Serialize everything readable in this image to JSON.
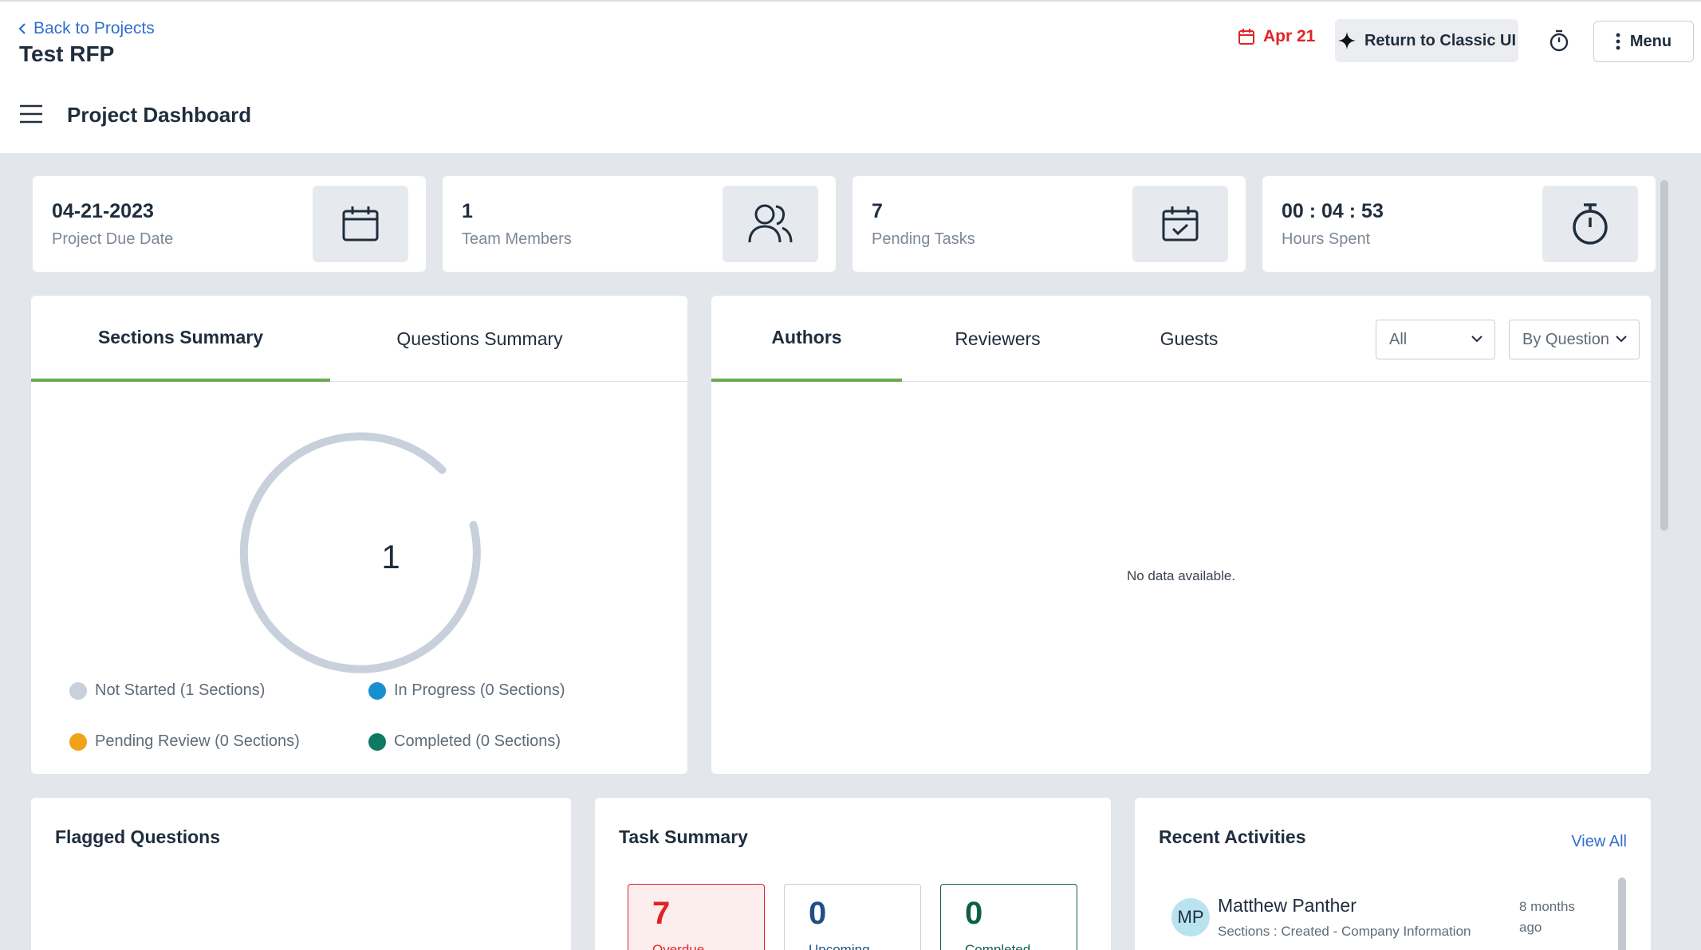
{
  "header": {
    "back_label": "Back to Projects",
    "project_title": "Test RFP",
    "due_label": "Apr 21",
    "classic_label": "Return to Classic UI",
    "menu_label": "Menu"
  },
  "subheader": {
    "title": "Project Dashboard"
  },
  "stats": [
    {
      "value": "04-21-2023",
      "label": "Project Due Date",
      "icon": "calendar-icon"
    },
    {
      "value": "1",
      "label": "Team Members",
      "icon": "users-icon"
    },
    {
      "value": "7",
      "label": "Pending Tasks",
      "icon": "calendar-check-icon"
    },
    {
      "value": "00 : 04 : 53",
      "label": "Hours Spent",
      "icon": "stopwatch-icon"
    }
  ],
  "summary": {
    "tabs": [
      "Sections Summary",
      "Questions Summary"
    ],
    "active_tab": 0,
    "center_value": "1",
    "legend": [
      {
        "label": "Not Started (1 Sections)",
        "color": "#c8d0dc"
      },
      {
        "label": "In Progress (0 Sections)",
        "color": "#1a8fd0"
      },
      {
        "label": "Pending Review (0 Sections)",
        "color": "#f0a31a"
      },
      {
        "label": "Completed (0 Sections)",
        "color": "#0f7a63"
      }
    ]
  },
  "team": {
    "tabs": [
      "Authors",
      "Reviewers",
      "Guests"
    ],
    "active_tab": 0,
    "filter_value": "All",
    "group_value": "By Question",
    "empty_text": "No data available."
  },
  "flagged": {
    "title": "Flagged Questions"
  },
  "tasks": {
    "title": "Task Summary",
    "boxes": [
      {
        "value": "7",
        "label": "Overdue",
        "color": "#e02424"
      },
      {
        "value": "0",
        "label": "Upcoming",
        "color": "#1f4f8a"
      },
      {
        "value": "0",
        "label": "Completed",
        "color": "#0f5e4a"
      }
    ]
  },
  "activities": {
    "title": "Recent Activities",
    "view_all": "View All",
    "items": [
      {
        "initials": "MP",
        "name": "Matthew Panther",
        "description": "Sections : Created - Company Information",
        "time": "8 months ago"
      }
    ]
  },
  "colors": {
    "accent": "#6aa84f",
    "link": "#2f6fd0",
    "danger": "#e02424"
  }
}
